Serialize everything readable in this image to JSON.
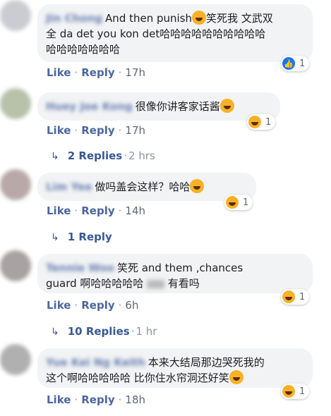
{
  "comments": [
    {
      "author": "Jin Chong",
      "text_1": "And then punish",
      "text_2": "笑死我 文武双",
      "text_3": "全 da det you kon det哈哈哈哈哈哈哈哈哈哈",
      "text_4": "哈哈哈哈哈哈哈",
      "reaction_count": "1",
      "reaction_icon": "like-icon",
      "like": "Like",
      "reply": "Reply",
      "time": "17h"
    },
    {
      "author": "Huey Joe Kong",
      "text_1": "很像你讲客家话酱",
      "reaction_count": "1",
      "reaction_icon": "haha-icon",
      "like": "Like",
      "reply": "Reply",
      "time": "17h",
      "replies_label": "2 Replies",
      "replies_time": "2 hrs"
    },
    {
      "author": "Lim Yee",
      "text_1": "做吗盖会这样？哈哈",
      "reaction_count": "1",
      "reaction_icon": "haha-icon",
      "like": "Like",
      "reply": "Reply",
      "time": "14h",
      "replies_label": "1 Reply"
    },
    {
      "author": "Tennie Woo",
      "text_1": "笑死 and them ,chances",
      "text_2": "guard 啊哈哈哈哈哈",
      "text_3": "有看吗",
      "reaction_count": "1",
      "reaction_icon": "haha-icon",
      "like": "Like",
      "reply": "Reply",
      "time": "6h",
      "replies_label": "10 Replies",
      "replies_time": "1 hr"
    },
    {
      "author": "Yue Kei Ng Keith",
      "text_1": "本来大结局那边哭死我的",
      "text_2": "这个啊哈哈哈哈哈 比你住水帘洞还好笑",
      "reaction_count": "1",
      "reaction_icon": "haha-icon",
      "like": "Like",
      "reply": "Reply",
      "time": "18h"
    }
  ],
  "separator": "·"
}
